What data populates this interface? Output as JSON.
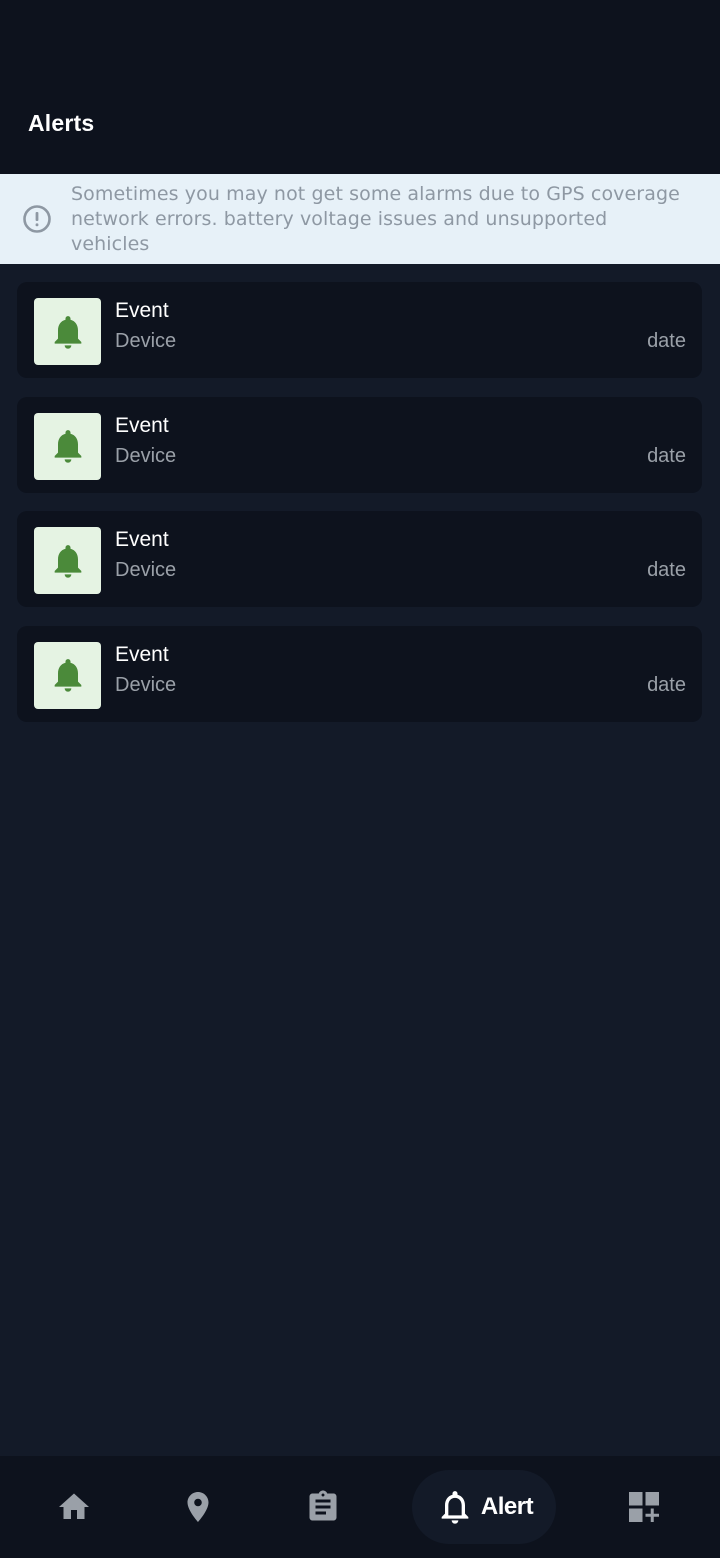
{
  "header": {
    "title": "Alerts"
  },
  "notice": {
    "icon": "info-circle-icon",
    "text": "Sometimes you may not get some alarms due to GPS coverage network errors. battery voltage issues and unsupported vehicles"
  },
  "alerts": [
    {
      "icon": "bell-icon",
      "event": "Event",
      "device": "Device",
      "date": "date"
    },
    {
      "icon": "bell-icon",
      "event": "Event",
      "device": "Device",
      "date": "date"
    },
    {
      "icon": "bell-icon",
      "event": "Event",
      "device": "Device",
      "date": "date"
    },
    {
      "icon": "bell-icon",
      "event": "Event",
      "device": "Device",
      "date": "date"
    }
  ],
  "nav": {
    "items": [
      {
        "icon": "home-icon"
      },
      {
        "icon": "location-pin-icon"
      },
      {
        "icon": "clipboard-icon"
      },
      {
        "icon": "bell-icon",
        "label": "Alert",
        "active": true
      },
      {
        "icon": "dashboard-add-icon"
      }
    ]
  },
  "colors": {
    "background": "#131a28",
    "header": "#0d121d",
    "notice_bg": "#e7f1f8",
    "bell_green": "#4b8a3a",
    "thumb_bg": "#e5f3e3",
    "nav_icon": "#9aa0a8"
  }
}
